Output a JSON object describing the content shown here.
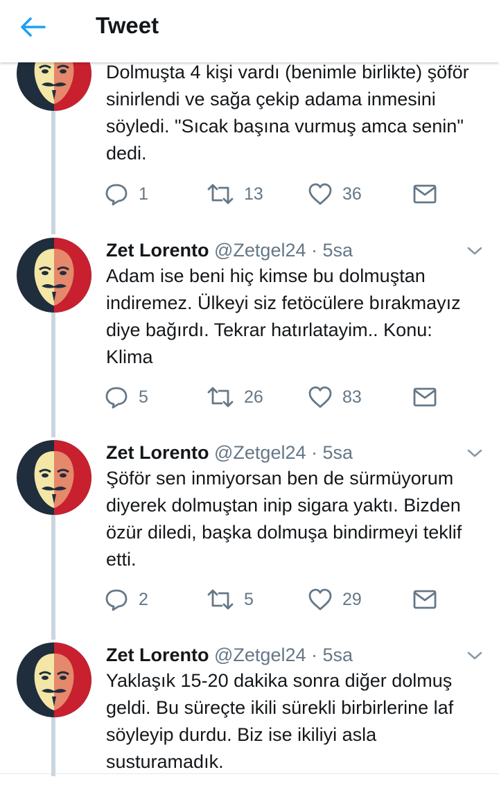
{
  "header": {
    "title": "Tweet",
    "back_icon": "arrow-left-icon",
    "accent": "#1da1f2"
  },
  "colors": {
    "text": "#14171a",
    "secondary": "#657786",
    "thread_line": "#cbd5dd"
  },
  "tweets": [
    {
      "name": "",
      "handle": "",
      "time": "",
      "text": "Dolmuşta 4 kişi vardı (benimle birlikte) şöför sinirlendi ve sağa çekip adama inmesini söyledi. \"Sıcak başına vurmuş amca senin\" dedi.",
      "replies": "1",
      "retweets": "13",
      "likes": "36"
    },
    {
      "name": "Zet Lorento",
      "handle": "@Zetgel24",
      "time": "5sa",
      "text": "Adam ise beni hiç kimse bu dolmuştan indiremez. Ülkeyi siz fetöcülere bırakmayız diye bağırdı. Tekrar hatırlatayim.. Konu: Klima",
      "replies": "5",
      "retweets": "26",
      "likes": "83"
    },
    {
      "name": "Zet Lorento",
      "handle": "@Zetgel24",
      "time": "5sa",
      "text": "Şöför sen inmiyorsan ben de sürmüyorum diyerek dolmuştan inip sigara yaktı. Bizden özür diledi, başka dolmuşa bindirmeyi teklif etti.",
      "replies": "2",
      "retweets": "5",
      "likes": "29"
    },
    {
      "name": "Zet Lorento",
      "handle": "@Zetgel24",
      "time": "5sa",
      "text": "Yaklaşık 15-20 dakika sonra diğer dolmuş geldi. Bu süreçte ikili sürekli birbirlerine laf söyleyip durdu. Biz ise ikiliyi asla susturamadık."
    }
  ],
  "separator": "·"
}
